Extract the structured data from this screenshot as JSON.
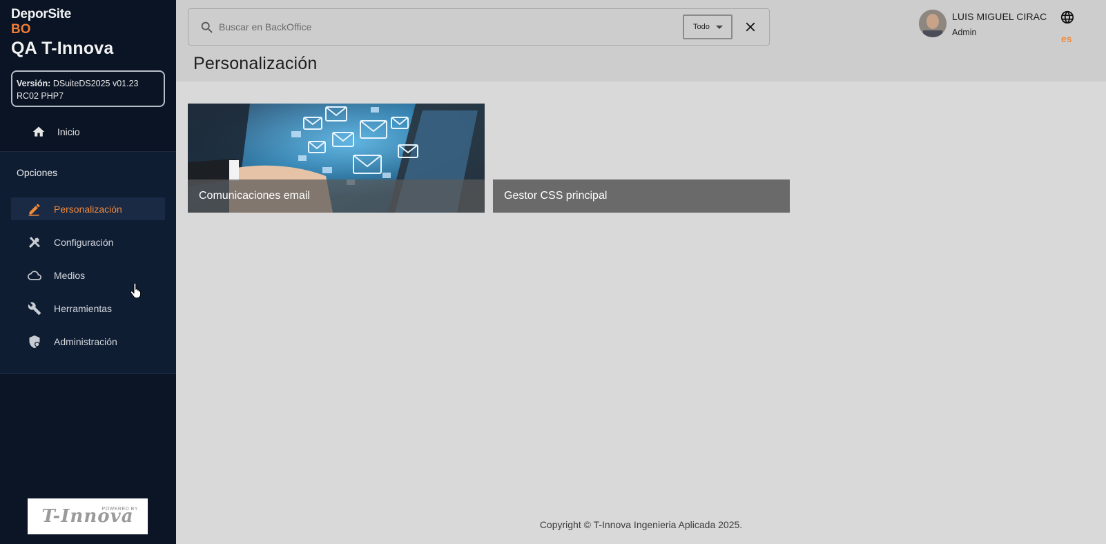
{
  "brand": {
    "line1": "DeporSite",
    "line2": "BO",
    "line3": "QA T-Innova",
    "accent_color": "#f07c34"
  },
  "version": {
    "label": "Versión:",
    "value": "DSuiteDS2025 v01.23 RC02 PHP7"
  },
  "nav": {
    "home_label": "Inicio",
    "home_icon": "home-icon"
  },
  "options": {
    "title": "Opciones",
    "items": [
      {
        "label": "Personalización",
        "icon": "pencil-icon",
        "active": true
      },
      {
        "label": "Configuración",
        "icon": "tools-icon",
        "active": false
      },
      {
        "label": "Medios",
        "icon": "cloud-icon",
        "active": false
      },
      {
        "label": "Herramientas",
        "icon": "wrench-icon",
        "active": false
      },
      {
        "label": "Administración",
        "icon": "shield-icon",
        "active": false
      }
    ]
  },
  "logo": {
    "powered": "POWERED BY",
    "text": "T-Innova"
  },
  "search": {
    "placeholder": "Buscar en BackOffice",
    "value": "",
    "scope": "Todo"
  },
  "user": {
    "name": "LUIS MIGUEL CIRAC",
    "role": "Admin"
  },
  "language": {
    "code": "es"
  },
  "page": {
    "title": "Personalización"
  },
  "cards": [
    {
      "label": "Comunicaciones email",
      "has_image": true
    },
    {
      "label": "Gestor CSS principal",
      "has_image": false
    }
  ],
  "footer": {
    "text": "Copyright © T-Innova Ingenieria Aplicada 2025."
  }
}
